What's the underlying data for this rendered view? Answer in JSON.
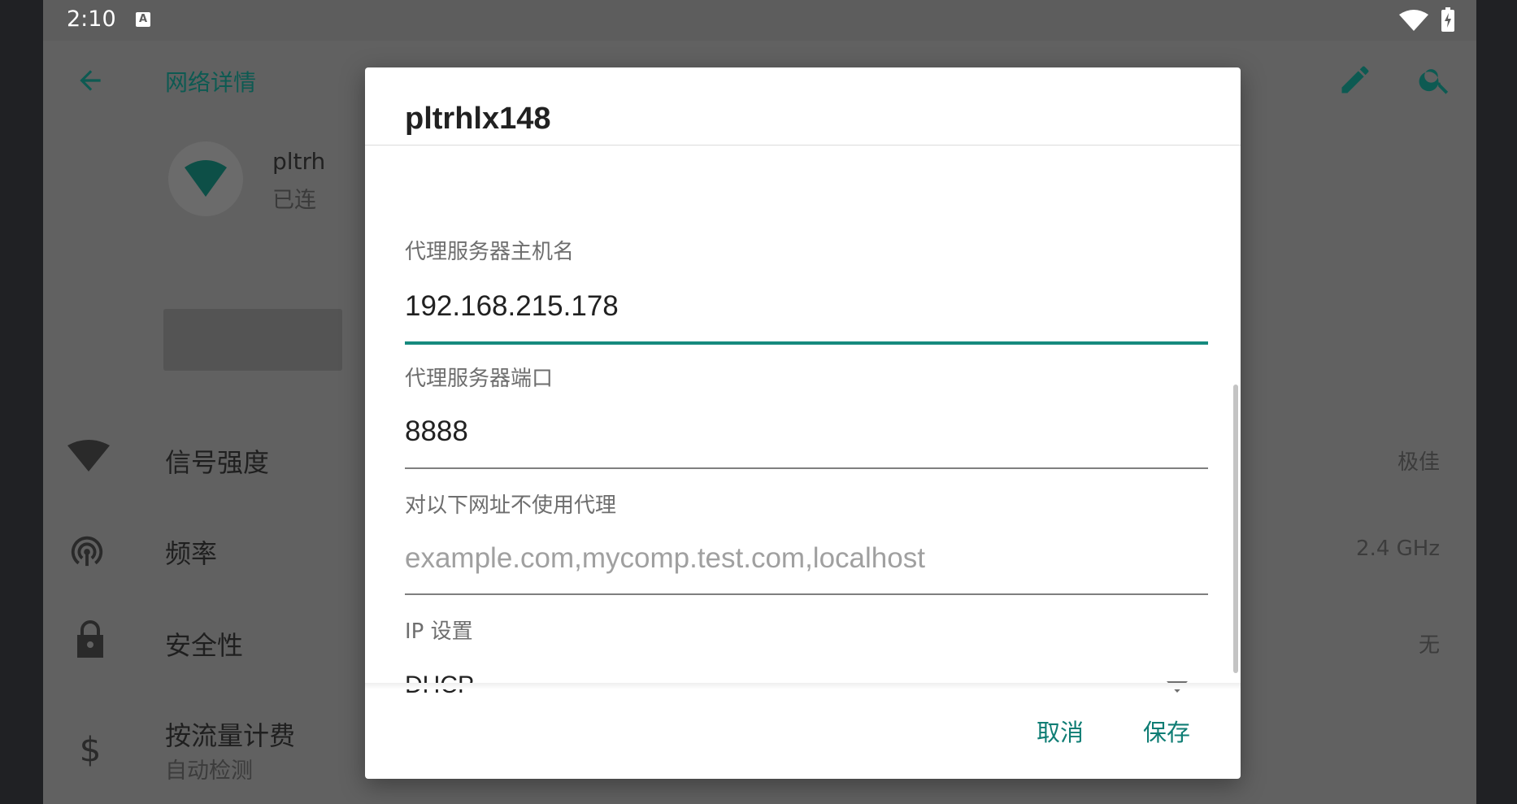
{
  "status_bar": {
    "time": "2:10",
    "notification_icon": "a-icon",
    "wifi_icon": "wifi-icon",
    "battery_icon": "battery-charging-icon"
  },
  "app_bar": {
    "title": "网络详情",
    "back_icon": "arrow-back-icon",
    "edit_icon": "pencil-icon",
    "search_icon": "search-icon"
  },
  "network_header": {
    "ssid": "pltrh",
    "status": "已连"
  },
  "details": [
    {
      "label": "信号强度",
      "value": "极佳",
      "icon": "wifi-signal-icon"
    },
    {
      "label": "频率",
      "value": "2.4 GHz",
      "icon": "antenna-icon"
    },
    {
      "label": "安全性",
      "value": "无",
      "icon": "lock-icon"
    },
    {
      "label": "按流量计费",
      "sub": "自动检测",
      "icon": "dollar-icon"
    }
  ],
  "dialog": {
    "title": "pltrhlx148",
    "fields": {
      "proxy_host_label": "代理服务器主机名",
      "proxy_host_value": "192.168.215.178",
      "proxy_port_label": "代理服务器端口",
      "proxy_port_value": "8888",
      "bypass_label": "对以下网址不使用代理",
      "bypass_placeholder": "example.com,mycomp.test.com,localhost",
      "ip_settings_label": "IP 设置",
      "ip_settings_value": "DHCP"
    },
    "buttons": {
      "cancel": "取消",
      "save": "保存"
    }
  },
  "colors": {
    "accent": "#168a7e",
    "scrim": "#616161",
    "dialog_bg": "#ffffff"
  }
}
